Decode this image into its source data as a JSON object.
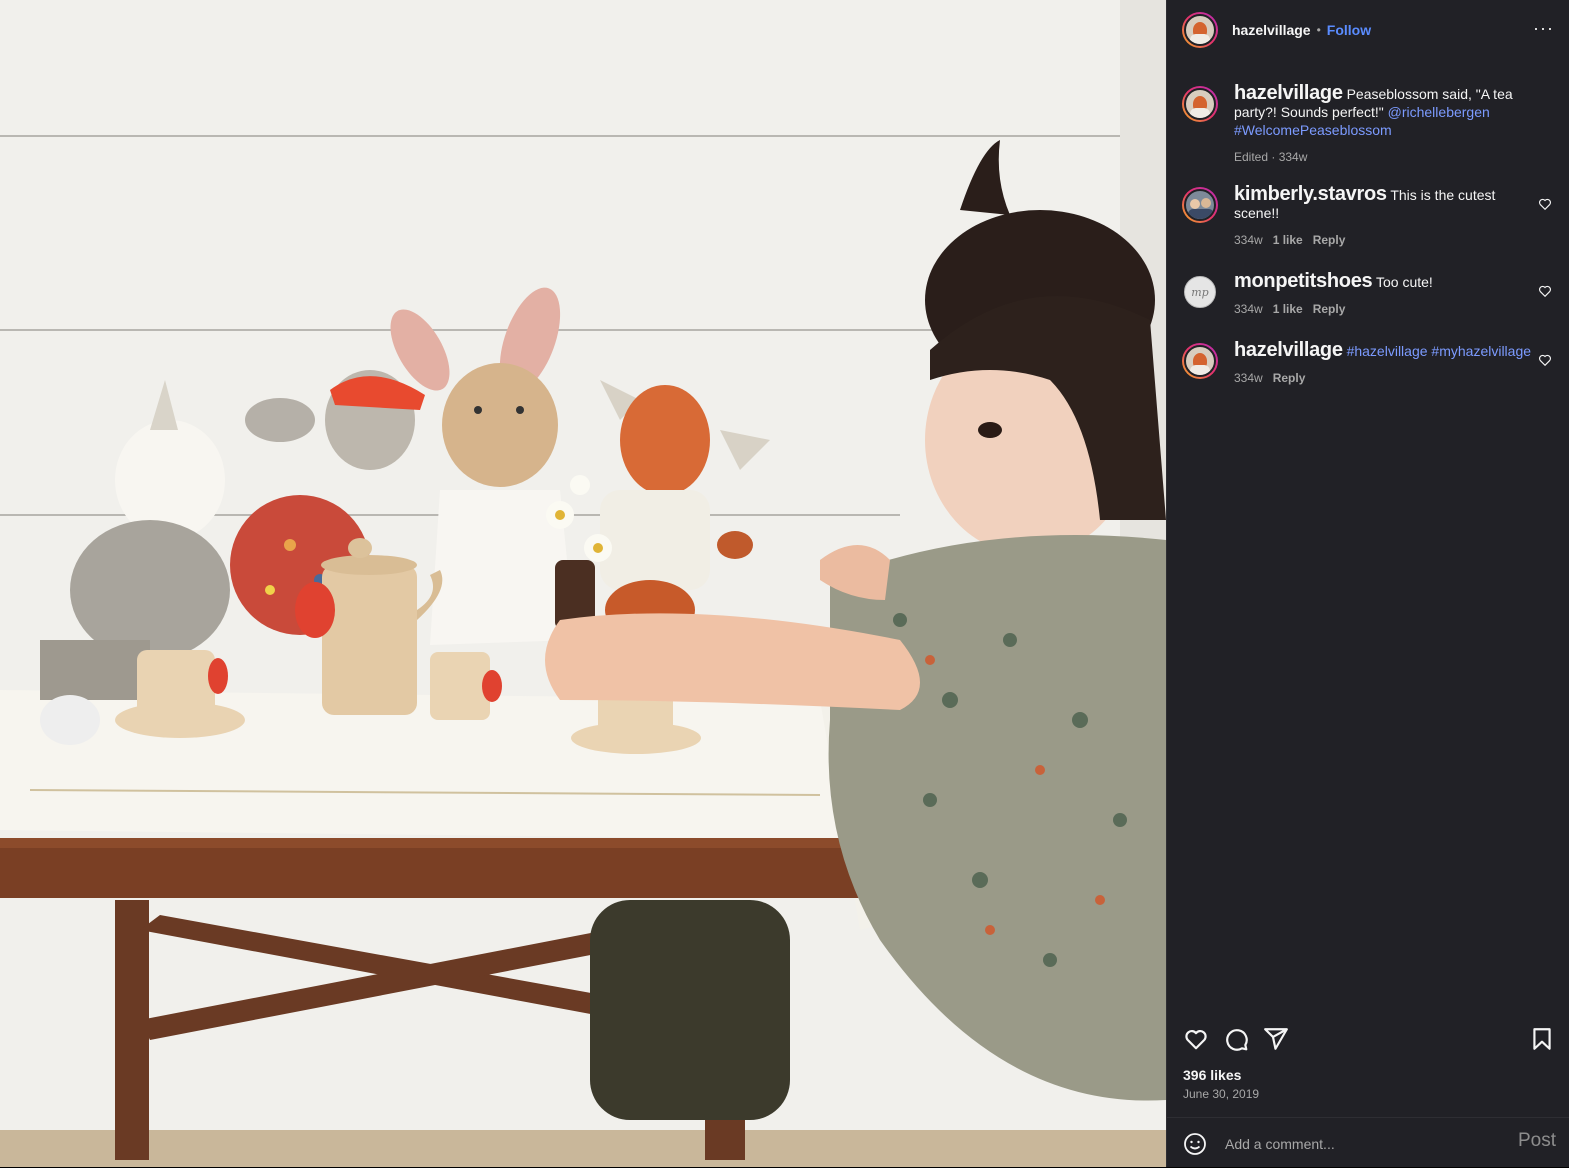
{
  "post": {
    "author": "hazelvillage",
    "follow_label": "Follow",
    "separator": "•",
    "more_label": "···",
    "caption": {
      "username": "hazelvillage",
      "text": "Peaseblossom said, \"A tea party?! Sounds perfect!\"",
      "mention": "@richellebergen",
      "hashtag": "#WelcomePeaseblossom",
      "meta": "Edited · 334w"
    },
    "comments": [
      {
        "username": "kimberly.stavros",
        "text": "This is the cutest scene!!",
        "age": "334w",
        "likes": "1 like",
        "reply": "Reply"
      },
      {
        "username": "monpetitshoes",
        "text": "Too cute!",
        "age": "334w",
        "likes": "1 like",
        "reply": "Reply",
        "avatar_text": "mp"
      },
      {
        "username": "hazelvillage",
        "tag1": "#hazelvillage",
        "tag2": "#myhazelvillage",
        "age": "334w",
        "reply": "Reply"
      }
    ],
    "likes": "396 likes",
    "date": "June 30, 2019",
    "comment_placeholder": "Add a comment...",
    "post_label": "Post"
  },
  "icons": [
    "heart-icon",
    "comment-icon",
    "share-icon",
    "bookmark-icon",
    "emoji-icon",
    "more-icon",
    "small-heart-icon"
  ],
  "colors": {
    "panel_bg": "#212126",
    "link": "#7c9bff",
    "follow": "#5a8cff",
    "muted": "#a8a8a8"
  }
}
